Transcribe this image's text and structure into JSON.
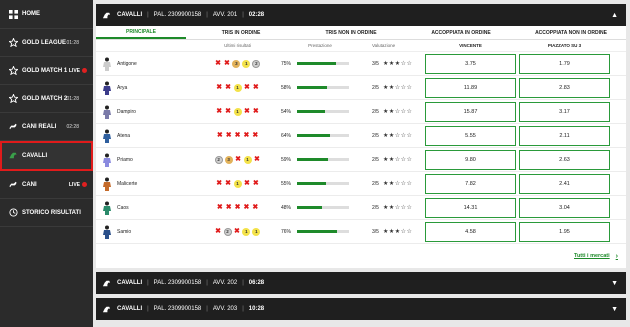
{
  "sidebar": {
    "items": [
      {
        "label": "HOME",
        "icon": "grid-icon",
        "time": "",
        "live": false
      },
      {
        "label": "GOLD LEAGUE",
        "icon": "star-icon",
        "time": "01:28",
        "live": false
      },
      {
        "label": "GOLD MATCH 1",
        "icon": "star-icon",
        "time": "",
        "live": true
      },
      {
        "label": "GOLD MATCH 2",
        "icon": "star-icon",
        "time": "01:28",
        "live": false
      },
      {
        "label": "CANI REALI",
        "icon": "dog-icon",
        "time": "02:28",
        "live": false
      },
      {
        "label": "CAVALLI",
        "icon": "horse-icon",
        "time": "",
        "live": false
      },
      {
        "label": "CANI",
        "icon": "dog-icon",
        "time": "",
        "live": true
      },
      {
        "label": "STORICO RISULTATI",
        "icon": "history-icon",
        "time": "",
        "live": false
      }
    ],
    "live_label": "LIVE"
  },
  "events": [
    {
      "name": "CAVALLI",
      "pal": "PAL. 2309900158",
      "avv": "AVV. 201",
      "time": "02:28",
      "expanded": true
    },
    {
      "name": "CAVALLI",
      "pal": "PAL. 2309900158",
      "avv": "AVV. 202",
      "time": "06:28",
      "expanded": false
    },
    {
      "name": "CAVALLI",
      "pal": "PAL. 2309900158",
      "avv": "AVV. 203",
      "time": "10:28",
      "expanded": false
    }
  ],
  "tabs": [
    "PRINCIPALE",
    "TRIS IN ORDINE",
    "TRIS NON IN ORDINE",
    "ACCOPPIATA IN ORDINE",
    "ACCOPPIATA NON IN ORDINE"
  ],
  "columns": {
    "results": "Ultimi risultati",
    "performance": "Prestazione",
    "rating": "Valutazione",
    "win": "VINCENTE",
    "place": "PIAZZATO SU 3"
  },
  "horses": [
    {
      "name": "Antigone",
      "results": [
        "x",
        "x",
        "3",
        "1",
        "2"
      ],
      "perf": 75,
      "perf_label": "75%",
      "rating": 3,
      "rating_label": "3/5",
      "win": "3.75",
      "place": "1.79",
      "silk": "#cccccc"
    },
    {
      "name": "Arya",
      "results": [
        "x",
        "x",
        "1",
        "x",
        "x"
      ],
      "perf": 58,
      "perf_label": "58%",
      "rating": 2,
      "rating_label": "2/5",
      "win": "11.89",
      "place": "2.83",
      "silk": "#3b3b8a"
    },
    {
      "name": "Dampiro",
      "results": [
        "x",
        "x",
        "1",
        "x",
        "x"
      ],
      "perf": 54,
      "perf_label": "54%",
      "rating": 2,
      "rating_label": "2/5",
      "win": "15.87",
      "place": "3.17",
      "silk": "#7a7aa8"
    },
    {
      "name": "Atena",
      "results": [
        "x",
        "x",
        "x",
        "x",
        "x"
      ],
      "perf": 64,
      "perf_label": "64%",
      "rating": 2,
      "rating_label": "2/5",
      "win": "5.55",
      "place": "2.11",
      "silk": "#2f5f9e"
    },
    {
      "name": "Priamo",
      "results": [
        "2",
        "3",
        "x",
        "1",
        "x"
      ],
      "perf": 59,
      "perf_label": "59%",
      "rating": 2,
      "rating_label": "2/5",
      "win": "9.80",
      "place": "2.63",
      "silk": "#8a8adf"
    },
    {
      "name": "Malicerte",
      "results": [
        "x",
        "x",
        "1",
        "x",
        "x"
      ],
      "perf": 55,
      "perf_label": "55%",
      "rating": 2,
      "rating_label": "2/5",
      "win": "7.82",
      "place": "2.41",
      "silk": "#c46a2a"
    },
    {
      "name": "Caos",
      "results": [
        "x",
        "x",
        "x",
        "x",
        "x"
      ],
      "perf": 48,
      "perf_label": "48%",
      "rating": 2,
      "rating_label": "2/5",
      "win": "14.31",
      "place": "3.04",
      "silk": "#2a8a6a"
    },
    {
      "name": "Samio",
      "results": [
        "x",
        "2",
        "x",
        "1",
        "1"
      ],
      "perf": 76,
      "perf_label": "76%",
      "rating": 3,
      "rating_label": "3/5",
      "win": "4.58",
      "place": "1.95",
      "silk": "#2a4f8a"
    }
  ],
  "all_markets_label": "Tutti i mercati",
  "colors": {
    "accent": "#1e8a2a",
    "loss": "#e01b1b",
    "dark": "#1f1f1f",
    "sidebar": "#2b2b2b"
  }
}
